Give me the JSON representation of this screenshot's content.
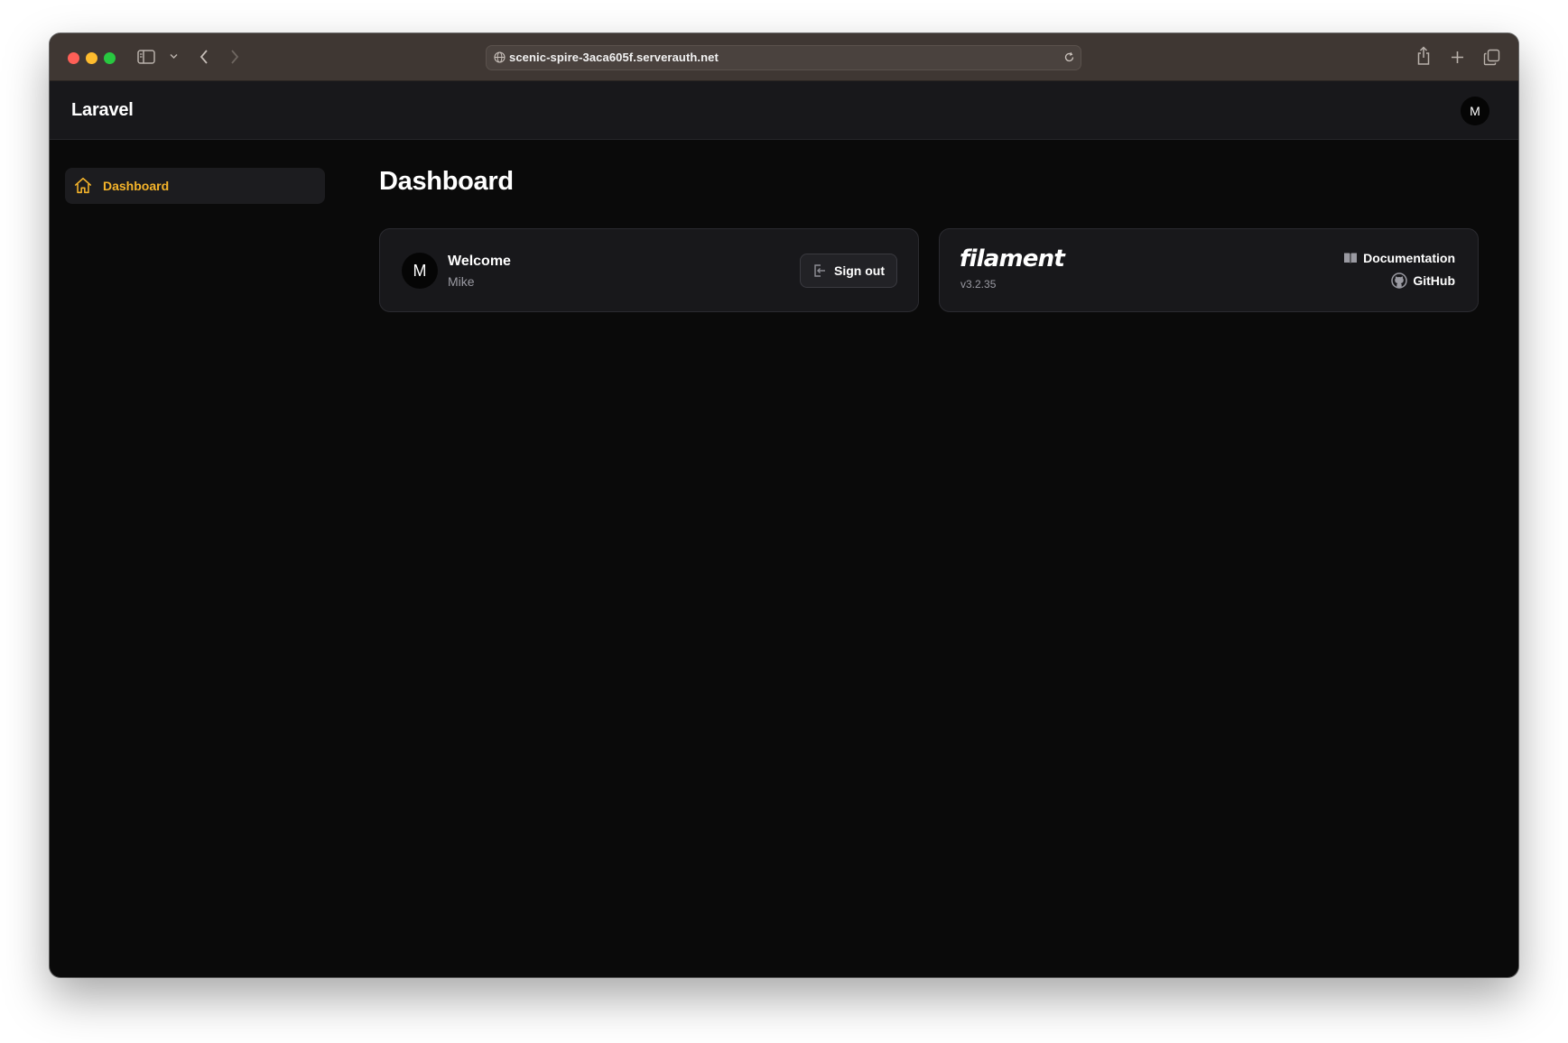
{
  "browser": {
    "url": "scenic-spire-3aca605f.serverauth.net"
  },
  "app": {
    "brand": "Laravel",
    "user_initial": "M"
  },
  "sidebar": {
    "items": [
      {
        "label": "Dashboard",
        "icon": "home-icon",
        "active": true
      }
    ]
  },
  "main": {
    "title": "Dashboard",
    "welcome_card": {
      "avatar_initial": "M",
      "title": "Welcome",
      "name": "Mike",
      "signout_label": "Sign out"
    },
    "filament_card": {
      "logo_text": "filament",
      "version": "v3.2.35",
      "documentation_label": "Documentation",
      "github_label": "GitHub"
    }
  },
  "colors": {
    "accent": "#f5b42a",
    "background": "#0a0a0a",
    "surface": "#18181b",
    "titlebar": "#3f3733"
  }
}
